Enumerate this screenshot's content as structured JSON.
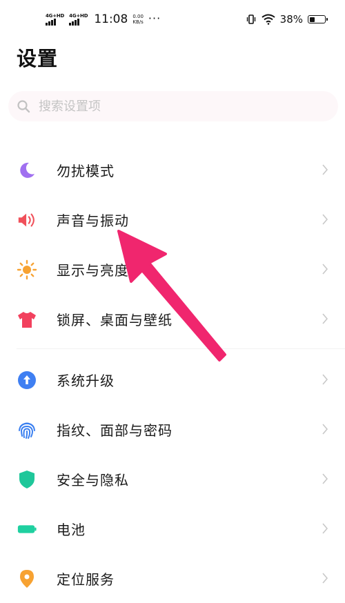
{
  "status_bar": {
    "signal1": "4G+HD",
    "signal2": "4G+HD",
    "time": "11:08",
    "speed_value": "0.00",
    "speed_unit": "KB/s",
    "more": "···",
    "battery": "38%",
    "battery_level": 0.38
  },
  "page": {
    "title": "设置"
  },
  "search": {
    "placeholder": "搜索设置项",
    "value": ""
  },
  "groups": [
    {
      "items": [
        {
          "label": "勿扰模式",
          "icon": "moon-icon",
          "color": "#a070f0"
        },
        {
          "label": "声音与振动",
          "icon": "speaker-icon",
          "color": "#f0505a"
        },
        {
          "label": "显示与亮度",
          "icon": "sun-icon",
          "color": "#f7a232"
        },
        {
          "label": "锁屏、桌面与壁纸",
          "icon": "shirt-icon",
          "color": "#f2415e"
        }
      ]
    },
    {
      "items": [
        {
          "label": "系统升级",
          "icon": "upgrade-icon",
          "color": "#3f7ff2"
        },
        {
          "label": "指纹、面部与密码",
          "icon": "fingerprint-icon",
          "color": "#3a7ff0"
        },
        {
          "label": "安全与隐私",
          "icon": "shield-icon",
          "color": "#1fc79a"
        },
        {
          "label": "电池",
          "icon": "battery-icon",
          "color": "#1fd0a0"
        },
        {
          "label": "定位服务",
          "icon": "location-pin-icon",
          "color": "#f7a232"
        }
      ]
    }
  ],
  "annotation": {
    "arrow_color": "#f0266e"
  }
}
